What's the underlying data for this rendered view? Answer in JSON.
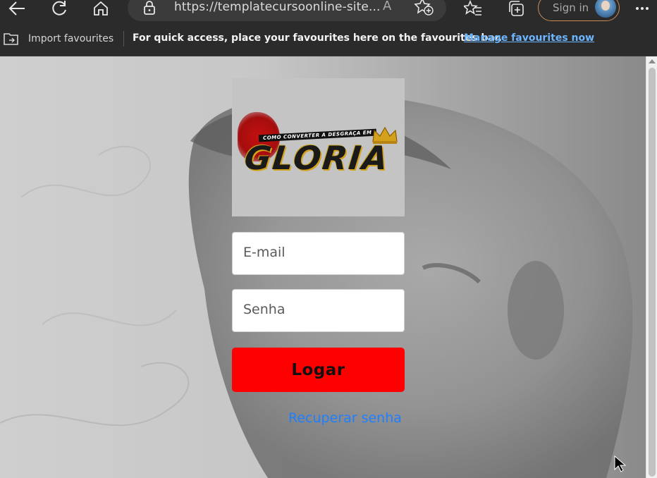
{
  "browser": {
    "url": "https://templatecursoonline-site...",
    "read_aloud_glyph": "A",
    "signin_label": "Sign in",
    "icons": [
      "back-icon",
      "refresh-icon",
      "home-icon",
      "lock-icon",
      "read-aloud-icon",
      "add-favourite-icon",
      "favourites-icon",
      "collections-icon",
      "more-icon"
    ]
  },
  "favourites_bar": {
    "import_label": "Import favourites",
    "tip": "For quick access, place your favourites here on the favourites bar.",
    "manage_link": "Manage favourites now"
  },
  "login": {
    "logo": {
      "tagline": "COMO CONVERTER A DESGRAÇA EM",
      "title": "GLORIA"
    },
    "email_placeholder": "E-mail",
    "password_placeholder": "Senha",
    "login_button": "Logar",
    "recover_link": "Recuperar senha"
  },
  "colors": {
    "login_button": "#ff0000",
    "recover_link": "#1e7fff",
    "manage_link": "#6cb5ff",
    "signin_border": "#c98b55"
  }
}
